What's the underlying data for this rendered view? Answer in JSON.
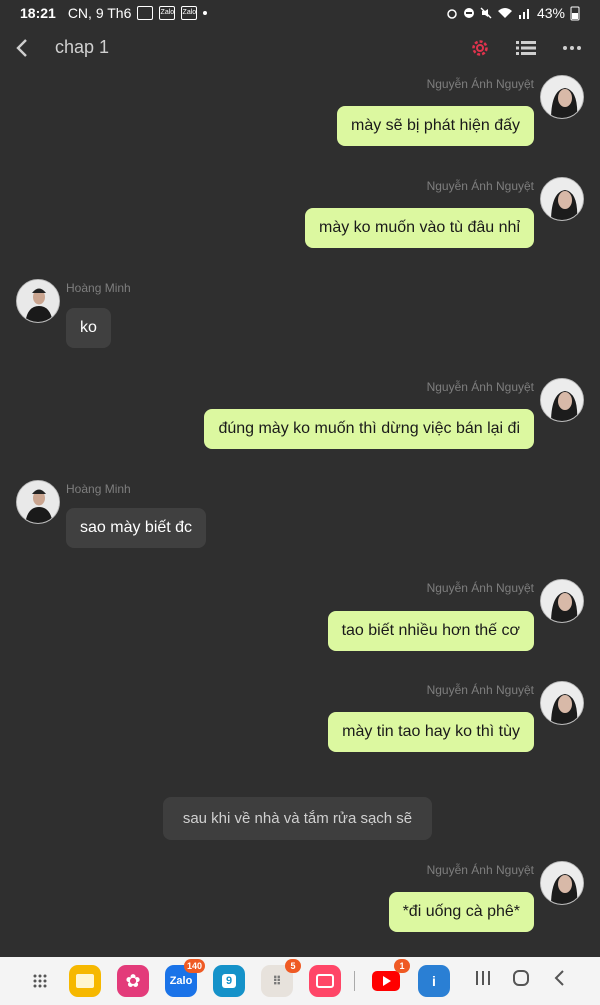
{
  "status_bar": {
    "time": "18:21",
    "date": "CN, 9 Th6",
    "notif_icons": [
      "gallery-icon",
      "zalo-icon",
      "zalo-icon"
    ],
    "notif_labels": [
      "",
      "Zalo",
      "Zalo"
    ],
    "battery": "43%"
  },
  "header": {
    "title": "chap 1"
  },
  "messages": [
    {
      "sender": "Nguyễn Ánh Nguyệt",
      "text": "mày sẽ bị phát hiện đấy",
      "side": "right"
    },
    {
      "sender": "Nguyễn Ánh Nguyệt",
      "text": "mày ko muốn vào tù đâu nhỉ",
      "side": "right"
    },
    {
      "sender": "Hoàng Minh",
      "text": "ko",
      "side": "left"
    },
    {
      "sender": "Nguyễn Ánh Nguyệt",
      "text": "đúng mày ko muốn thì dừng việc bán lại đi",
      "side": "right"
    },
    {
      "sender": "Hoàng Minh",
      "text": "sao mày biết đc",
      "side": "left"
    },
    {
      "sender": "Nguyễn Ánh Nguyệt",
      "text": "tao biết nhiều hơn thế cơ",
      "side": "right"
    },
    {
      "sender": "Nguyễn Ánh Nguyệt",
      "text": "mày tin tao hay ko thì tùy",
      "side": "right"
    },
    {
      "sender": "Nguyễn Ánh Nguyệt",
      "text": "*đi uống cà phê*",
      "side": "right"
    }
  ],
  "narration": "sau khi về nhà và tắm rửa sạch sẽ",
  "nav_bar": {
    "apps": [
      {
        "icon": "grid-icon",
        "badge": ""
      },
      {
        "icon": "folder-icon",
        "badge": ""
      },
      {
        "icon": "flower-icon",
        "badge": ""
      },
      {
        "icon": "zalo-icon",
        "badge": "140",
        "label": "Zalo"
      },
      {
        "icon": "calendar-icon",
        "badge": "",
        "label": "9"
      },
      {
        "icon": "apps-folder-icon",
        "badge": "5"
      },
      {
        "icon": "camera-icon",
        "badge": ""
      },
      {
        "icon": "youtube-icon",
        "badge": "1"
      },
      {
        "icon": "ibis-paint-icon",
        "badge": ""
      }
    ]
  },
  "colors": {
    "background": "#2f2f2f",
    "my_bubble": "#dcf8a0",
    "other_bubble": "#404040",
    "accent_settings": "#e0334d"
  }
}
